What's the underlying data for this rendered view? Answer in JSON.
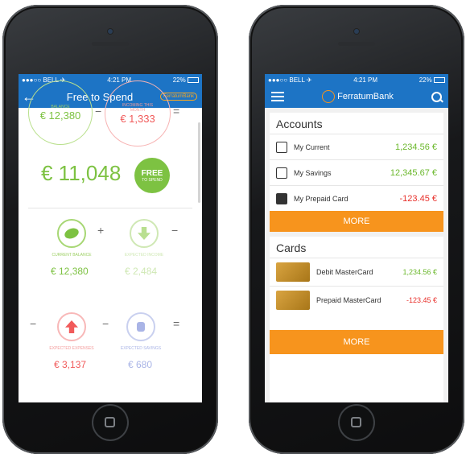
{
  "left": {
    "status": {
      "carrier": "●●●○○ BELL ✈",
      "time": "4:21 PM",
      "battery": "22%"
    },
    "nav": {
      "title": "Free to Spend",
      "logo": "FerratumBank"
    },
    "balance": {
      "label": "BALANCE",
      "value": "€ 12,380"
    },
    "incoming": {
      "label": "INCOMING THIS MONTH",
      "value": "€ 1,333"
    },
    "free_total": "€ 11,048",
    "free_badge": "FREE",
    "free_badge_sub": "TO SPEND",
    "current_balance": {
      "label": "CURRENT BALANCE",
      "value": "€ 12,380"
    },
    "expected_income": {
      "label": "EXPECTED INCOME",
      "value": "€ 2,484"
    },
    "expected_expenses": {
      "label": "EXPECTED EXPENSES",
      "value": "€ 3,137"
    },
    "expected_savings": {
      "label": "EXPECTED SAVINGS",
      "value": "€ 680"
    },
    "ops": {
      "minus": "−",
      "plus": "+",
      "equals": "="
    }
  },
  "right": {
    "status": {
      "carrier": "●●●○○ BELL ✈",
      "time": "4:21 PM",
      "battery": "22%"
    },
    "nav": {
      "logo": "FerratumBank"
    },
    "accounts_title": "Accounts",
    "accounts": [
      {
        "name": "My Current",
        "amount": "1,234.56 €",
        "color": "#6bb82c"
      },
      {
        "name": "My Savings",
        "amount": "12,345.67 €",
        "color": "#6bb82c"
      },
      {
        "name": "My Prepaid Card",
        "amount": "-123.45 €",
        "color": "#e8302b"
      }
    ],
    "more_label": "MORE",
    "cards_title": "Cards",
    "cards": [
      {
        "name": "Debit MasterCard",
        "amount": "1,234.56 €",
        "color": "#6bb82c"
      },
      {
        "name": "Prepaid  MasterCard",
        "amount": "-123.45 €",
        "color": "#e8302b"
      }
    ],
    "more_label2": "MORE"
  },
  "colors": {
    "blue": "#1d74c5",
    "green": "#7dc242",
    "red": "#f15a5a",
    "orange": "#f7941d",
    "lavender": "#a9b4e6"
  }
}
